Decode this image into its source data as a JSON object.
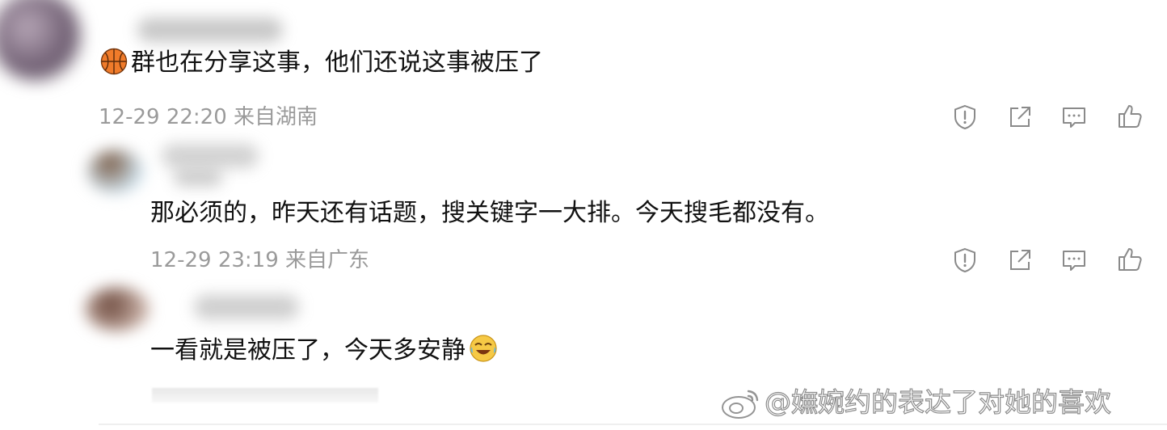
{
  "comments": [
    {
      "text": "群也在分享这事，他们还说这事被压了",
      "emoji_prefix": "basketball-emoji",
      "time": "12-29 22:20",
      "location": "来自湖南"
    },
    {
      "text": "那必须的，昨天还有话题，搜关键字一大排。今天搜毛都没有。",
      "time": "12-29 23:19",
      "location": "来自广东"
    },
    {
      "text": "一看就是被压了，今天多安静",
      "emoji_suffix": "laugh-cry-emoji"
    }
  ],
  "actions": [
    "report-icon",
    "share-icon",
    "comment-icon",
    "like-icon"
  ],
  "watermark": "@嫵婉约的表达了对她的喜欢",
  "colors": {
    "text": "#111111",
    "meta": "#9a9a9a",
    "icon": "#8a8a8a"
  }
}
